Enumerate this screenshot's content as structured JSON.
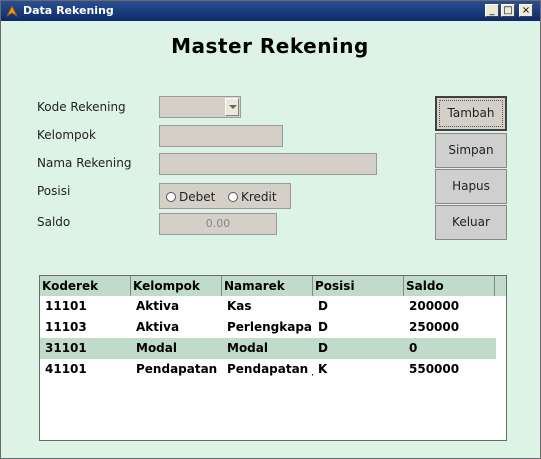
{
  "window": {
    "title": "Data Rekening",
    "minimize": "_",
    "maximize": "□",
    "close": "×"
  },
  "heading": "Master Rekening",
  "form": {
    "kode_label": "Kode Rekening",
    "kelompok_label": "Kelompok",
    "nama_label": "Nama Rekening",
    "posisi_label": "Posisi",
    "saldo_label": "Saldo",
    "posisi_options": [
      "Debet",
      "Kredit"
    ],
    "saldo_value": "0.00"
  },
  "buttons": {
    "tambah": "Tambah",
    "simpan": "Simpan",
    "hapus": "Hapus",
    "keluar": "Keluar"
  },
  "table": {
    "columns": [
      "Koderek",
      "Kelompok",
      "Namarek",
      "Posisi",
      "Saldo"
    ],
    "rows": [
      [
        "11101",
        "Aktiva",
        "Kas",
        "D",
        "200000"
      ],
      [
        "11103",
        "Aktiva",
        "Perlengkapan",
        "D",
        "250000"
      ],
      [
        "31101",
        "Modal",
        "Modal",
        "D",
        "0"
      ],
      [
        "41101",
        "Pendapatan",
        "Pendapatan ja",
        "K",
        "550000"
      ]
    ],
    "selected_row": 2
  },
  "colors": {
    "background": "#ddf3e6",
    "header_bg": "#c0dcc8",
    "titlebar": "#0b2a6b"
  }
}
